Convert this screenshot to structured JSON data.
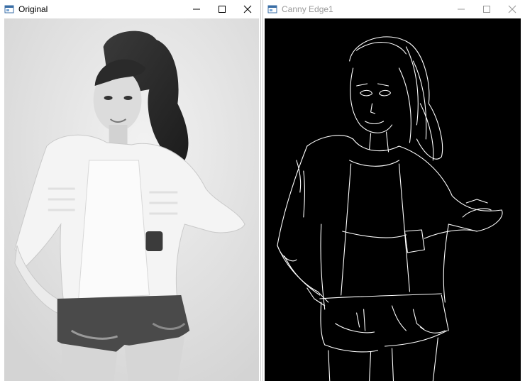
{
  "windows": {
    "original": {
      "title": "Original",
      "controls": [
        "minimize",
        "maximize",
        "close"
      ]
    },
    "canny": {
      "title": "Canny Edge1",
      "controls": [
        "minimize",
        "maximize",
        "close"
      ]
    }
  },
  "icons": {
    "app": "window-app-icon",
    "minimize": "minimize-icon",
    "maximize": "maximize-icon",
    "close": "close-icon"
  },
  "colors": {
    "edge_background": "#000000",
    "edge_lines": "#ffffff",
    "inactive_title": "#999999"
  }
}
